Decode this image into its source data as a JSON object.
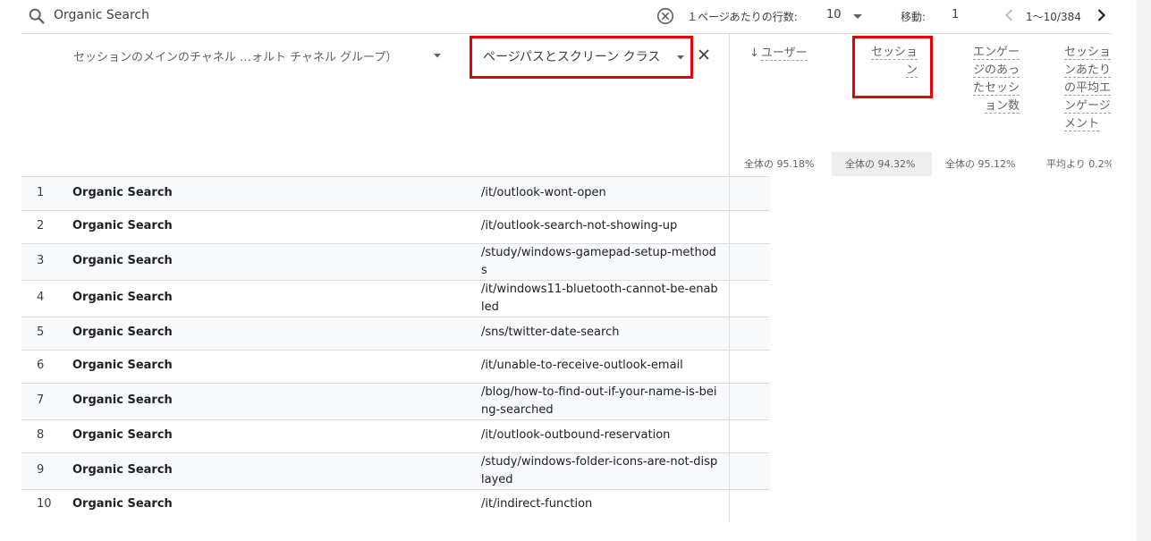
{
  "toolbar": {
    "search_value": "Organic Search",
    "rows_per_page_label": "１ページあたりの行数:",
    "rows_per_page_value": "10",
    "goto_label": "移動:",
    "goto_value": "1",
    "page_range": "1〜10/384"
  },
  "dimensions": {
    "primary_label": "セッションのメインのチャネル …ォルト チャネル グループ）",
    "secondary_label": "ページパスとスクリーン クラス"
  },
  "metrics": {
    "users": {
      "label": "ユーザー",
      "summary": "全体の 95.18%"
    },
    "sessions": {
      "label": "セッション",
      "summary": "全体の 94.32%"
    },
    "engaged_sessions": {
      "label": "エンゲージのあったセッション数",
      "summary": "全体の 95.12%"
    },
    "avg_engagement": {
      "label": "セッションあたりの平均エンゲージメント",
      "summary": "平均より 0.2%"
    }
  },
  "rows": [
    {
      "num": "1",
      "channel": "Organic Search",
      "path": "/it/outlook-wont-open"
    },
    {
      "num": "2",
      "channel": "Organic Search",
      "path": "/it/outlook-search-not-showing-up"
    },
    {
      "num": "3",
      "channel": "Organic Search",
      "path": "/study/windows-gamepad-setup-methods"
    },
    {
      "num": "4",
      "channel": "Organic Search",
      "path": "/it/windows11-bluetooth-cannot-be-enabled"
    },
    {
      "num": "5",
      "channel": "Organic Search",
      "path": "/sns/twitter-date-search"
    },
    {
      "num": "6",
      "channel": "Organic Search",
      "path": "/it/unable-to-receive-outlook-email"
    },
    {
      "num": "7",
      "channel": "Organic Search",
      "path": "/blog/how-to-find-out-if-your-name-is-being-searched"
    },
    {
      "num": "8",
      "channel": "Organic Search",
      "path": "/it/outlook-outbound-reservation"
    },
    {
      "num": "9",
      "channel": "Organic Search",
      "path": "/study/windows-folder-icons-are-not-displayed"
    },
    {
      "num": "10",
      "channel": "Organic Search",
      "path": "/it/indirect-function"
    }
  ],
  "colors": {
    "highlight": "#e8000b",
    "row_alt": "#f8f9fa",
    "divider": "#dadce0"
  }
}
